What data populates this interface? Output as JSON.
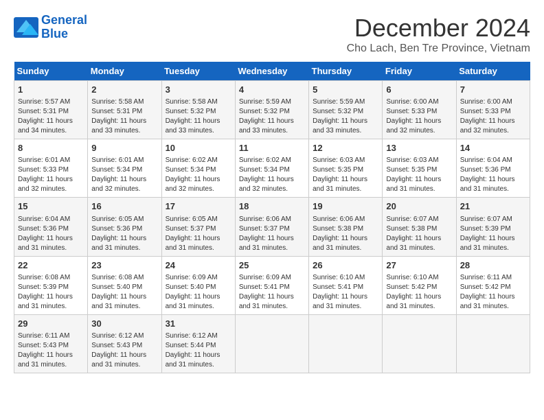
{
  "logo": {
    "line1": "General",
    "line2": "Blue"
  },
  "title": "December 2024",
  "subtitle": "Cho Lach, Ben Tre Province, Vietnam",
  "days_header": [
    "Sunday",
    "Monday",
    "Tuesday",
    "Wednesday",
    "Thursday",
    "Friday",
    "Saturday"
  ],
  "weeks": [
    [
      {
        "day": "1",
        "detail": "Sunrise: 5:57 AM\nSunset: 5:31 PM\nDaylight: 11 hours\nand 34 minutes."
      },
      {
        "day": "2",
        "detail": "Sunrise: 5:58 AM\nSunset: 5:31 PM\nDaylight: 11 hours\nand 33 minutes."
      },
      {
        "day": "3",
        "detail": "Sunrise: 5:58 AM\nSunset: 5:32 PM\nDaylight: 11 hours\nand 33 minutes."
      },
      {
        "day": "4",
        "detail": "Sunrise: 5:59 AM\nSunset: 5:32 PM\nDaylight: 11 hours\nand 33 minutes."
      },
      {
        "day": "5",
        "detail": "Sunrise: 5:59 AM\nSunset: 5:32 PM\nDaylight: 11 hours\nand 33 minutes."
      },
      {
        "day": "6",
        "detail": "Sunrise: 6:00 AM\nSunset: 5:33 PM\nDaylight: 11 hours\nand 32 minutes."
      },
      {
        "day": "7",
        "detail": "Sunrise: 6:00 AM\nSunset: 5:33 PM\nDaylight: 11 hours\nand 32 minutes."
      }
    ],
    [
      {
        "day": "8",
        "detail": "Sunrise: 6:01 AM\nSunset: 5:33 PM\nDaylight: 11 hours\nand 32 minutes."
      },
      {
        "day": "9",
        "detail": "Sunrise: 6:01 AM\nSunset: 5:34 PM\nDaylight: 11 hours\nand 32 minutes."
      },
      {
        "day": "10",
        "detail": "Sunrise: 6:02 AM\nSunset: 5:34 PM\nDaylight: 11 hours\nand 32 minutes."
      },
      {
        "day": "11",
        "detail": "Sunrise: 6:02 AM\nSunset: 5:34 PM\nDaylight: 11 hours\nand 32 minutes."
      },
      {
        "day": "12",
        "detail": "Sunrise: 6:03 AM\nSunset: 5:35 PM\nDaylight: 11 hours\nand 31 minutes."
      },
      {
        "day": "13",
        "detail": "Sunrise: 6:03 AM\nSunset: 5:35 PM\nDaylight: 11 hours\nand 31 minutes."
      },
      {
        "day": "14",
        "detail": "Sunrise: 6:04 AM\nSunset: 5:36 PM\nDaylight: 11 hours\nand 31 minutes."
      }
    ],
    [
      {
        "day": "15",
        "detail": "Sunrise: 6:04 AM\nSunset: 5:36 PM\nDaylight: 11 hours\nand 31 minutes."
      },
      {
        "day": "16",
        "detail": "Sunrise: 6:05 AM\nSunset: 5:36 PM\nDaylight: 11 hours\nand 31 minutes."
      },
      {
        "day": "17",
        "detail": "Sunrise: 6:05 AM\nSunset: 5:37 PM\nDaylight: 11 hours\nand 31 minutes."
      },
      {
        "day": "18",
        "detail": "Sunrise: 6:06 AM\nSunset: 5:37 PM\nDaylight: 11 hours\nand 31 minutes."
      },
      {
        "day": "19",
        "detail": "Sunrise: 6:06 AM\nSunset: 5:38 PM\nDaylight: 11 hours\nand 31 minutes."
      },
      {
        "day": "20",
        "detail": "Sunrise: 6:07 AM\nSunset: 5:38 PM\nDaylight: 11 hours\nand 31 minutes."
      },
      {
        "day": "21",
        "detail": "Sunrise: 6:07 AM\nSunset: 5:39 PM\nDaylight: 11 hours\nand 31 minutes."
      }
    ],
    [
      {
        "day": "22",
        "detail": "Sunrise: 6:08 AM\nSunset: 5:39 PM\nDaylight: 11 hours\nand 31 minutes."
      },
      {
        "day": "23",
        "detail": "Sunrise: 6:08 AM\nSunset: 5:40 PM\nDaylight: 11 hours\nand 31 minutes."
      },
      {
        "day": "24",
        "detail": "Sunrise: 6:09 AM\nSunset: 5:40 PM\nDaylight: 11 hours\nand 31 minutes."
      },
      {
        "day": "25",
        "detail": "Sunrise: 6:09 AM\nSunset: 5:41 PM\nDaylight: 11 hours\nand 31 minutes."
      },
      {
        "day": "26",
        "detail": "Sunrise: 6:10 AM\nSunset: 5:41 PM\nDaylight: 11 hours\nand 31 minutes."
      },
      {
        "day": "27",
        "detail": "Sunrise: 6:10 AM\nSunset: 5:42 PM\nDaylight: 11 hours\nand 31 minutes."
      },
      {
        "day": "28",
        "detail": "Sunrise: 6:11 AM\nSunset: 5:42 PM\nDaylight: 11 hours\nand 31 minutes."
      }
    ],
    [
      {
        "day": "29",
        "detail": "Sunrise: 6:11 AM\nSunset: 5:43 PM\nDaylight: 11 hours\nand 31 minutes."
      },
      {
        "day": "30",
        "detail": "Sunrise: 6:12 AM\nSunset: 5:43 PM\nDaylight: 11 hours\nand 31 minutes."
      },
      {
        "day": "31",
        "detail": "Sunrise: 6:12 AM\nSunset: 5:44 PM\nDaylight: 11 hours\nand 31 minutes."
      },
      {
        "day": "",
        "detail": ""
      },
      {
        "day": "",
        "detail": ""
      },
      {
        "day": "",
        "detail": ""
      },
      {
        "day": "",
        "detail": ""
      }
    ]
  ]
}
